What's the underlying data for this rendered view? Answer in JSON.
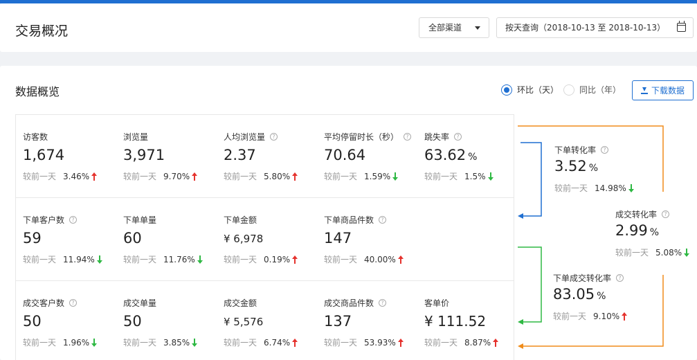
{
  "header": {
    "title": "交易概况",
    "channel_select": "全部渠道",
    "date_query": "按天查询（2018-10-13 至 2018-10-13）"
  },
  "overview": {
    "title": "数据概览",
    "compare_options": [
      {
        "label": "环比（天）",
        "selected": true
      },
      {
        "label": "同比（年）",
        "selected": false
      }
    ],
    "download_label": "下载数据",
    "compare_prefix": "较前一天"
  },
  "metrics": {
    "visitors": {
      "label": "访客数",
      "value": "1,674",
      "change": "3.46%",
      "trend": "up"
    },
    "pageviews": {
      "label": "浏览量",
      "value": "3,971",
      "change": "9.70%",
      "trend": "up"
    },
    "pv_per_user": {
      "label": "人均浏览量",
      "value": "2.37",
      "change": "5.80%",
      "trend": "up"
    },
    "avg_stay": {
      "label": "平均停留时长（秒）",
      "value": "70.64",
      "change": "1.59%",
      "trend": "down"
    },
    "bounce_rate": {
      "label": "跳失率",
      "value": "63.62",
      "unit": "%",
      "change": "1.5%",
      "trend": "down"
    },
    "order_customers": {
      "label": "下单客户数",
      "value": "59",
      "change": "11.94%",
      "trend": "down"
    },
    "order_count": {
      "label": "下单单量",
      "value": "60",
      "change": "11.76%",
      "trend": "down"
    },
    "order_amount": {
      "label": "下单金额",
      "value": "¥ 6,978",
      "change": "0.19%",
      "trend": "up"
    },
    "order_items": {
      "label": "下单商品件数",
      "value": "147",
      "change": "40.00%",
      "trend": "up"
    },
    "deal_customers": {
      "label": "成交客户数",
      "value": "50",
      "change": "1.96%",
      "trend": "down"
    },
    "deal_count": {
      "label": "成交单量",
      "value": "50",
      "change": "3.85%",
      "trend": "down"
    },
    "deal_amount": {
      "label": "成交金额",
      "value": "¥ 5,576",
      "change": "6.74%",
      "trend": "up"
    },
    "deal_items": {
      "label": "成交商品件数",
      "value": "137",
      "change": "53.93%",
      "trend": "up"
    },
    "unit_price": {
      "label": "客单价",
      "value": "¥ 111.52",
      "change": "8.87%",
      "trend": "up"
    }
  },
  "funnel": {
    "order_conversion": {
      "label": "下单转化率",
      "value": "3.52",
      "unit": "%",
      "change": "14.98%",
      "trend": "down"
    },
    "deal_conversion": {
      "label": "成交转化率",
      "value": "2.99",
      "unit": "%",
      "change": "5.08%",
      "trend": "down"
    },
    "order_deal_conversion": {
      "label": "下单成交转化率",
      "value": "83.05",
      "unit": "%",
      "change": "9.10%",
      "trend": "up"
    },
    "colors": {
      "blue": "#1f6fd1",
      "green": "#2eb843",
      "orange": "#f08c1a"
    }
  },
  "colors": {
    "accent": "#1f6fd1",
    "up": "#e5322d",
    "down": "#2eb843"
  }
}
